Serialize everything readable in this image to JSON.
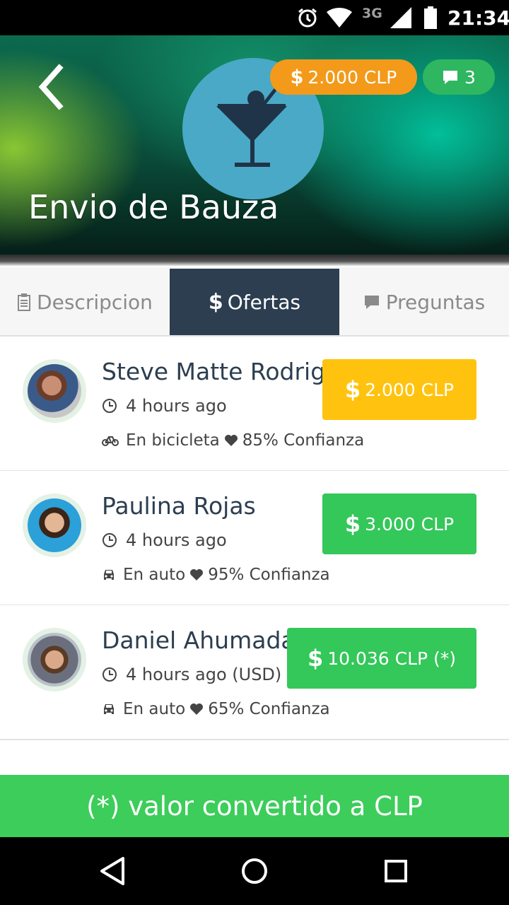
{
  "status_bar": {
    "network": "3G",
    "time": "21:34",
    "icons": [
      "alarm-icon",
      "wifi-icon",
      "signal-icon",
      "battery-icon"
    ]
  },
  "header": {
    "title": "Envio de Bauza",
    "price_badge": "2.000 CLP",
    "comments_count": "3",
    "category_icon": "cocktail-icon",
    "colors": {
      "price_badge": "#f39a1b",
      "comments_badge": "#2fb661",
      "category_circle": "#4aa9c6"
    }
  },
  "tabs": [
    {
      "label": "Descripcion",
      "icon": "clipboard-icon",
      "active": false
    },
    {
      "label": "Ofertas",
      "icon": "dollar-icon",
      "active": true
    },
    {
      "label": "Preguntas",
      "icon": "comment-icon",
      "active": false
    }
  ],
  "offers": [
    {
      "name": "Steve Matte Rodrigo",
      "time": "4 hours ago",
      "transport_icon": "bicycle-icon",
      "transport": "En bicicleta",
      "trust": "85% Confianza",
      "price": "2.000 CLP",
      "button_color": "#ffc30f"
    },
    {
      "name": "Paulina Rojas",
      "time": "4 hours ago",
      "transport_icon": "car-icon",
      "transport": "En auto",
      "trust": "95% Confianza",
      "price": "3.000 CLP",
      "button_color": "#34c759"
    },
    {
      "name": "Daniel Ahumada",
      "time": "4 hours ago (USD)",
      "transport_icon": "car-icon",
      "transport": "En auto",
      "trust": "65% Confianza",
      "price": "10.036 CLP (*)",
      "button_color": "#34c759"
    }
  ],
  "footer": {
    "note": "(*) valor convertido a CLP"
  },
  "colors": {
    "tab_active": "#2c3e50",
    "footer": "#3ccd5a",
    "name_text": "#2c3e50"
  }
}
